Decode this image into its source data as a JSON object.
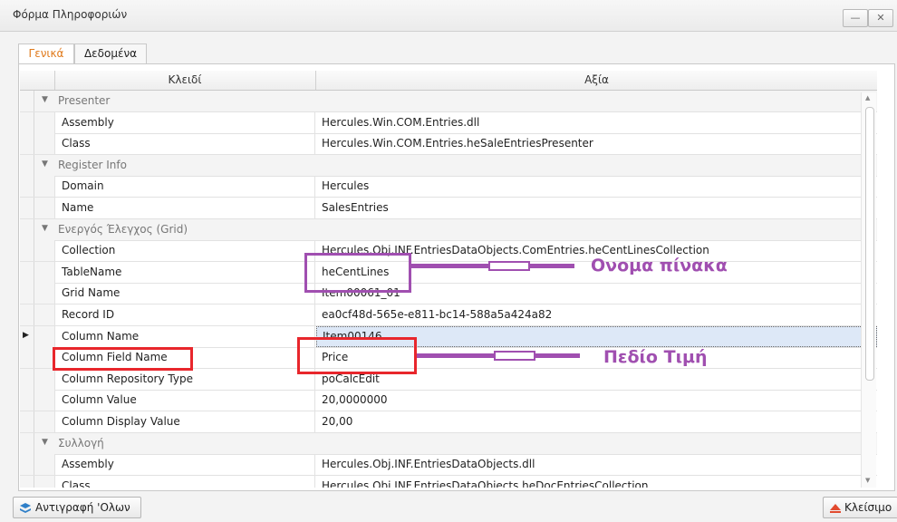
{
  "window": {
    "title": "Φόρμα Πληροφοριών",
    "minimize": "—",
    "close": "✕"
  },
  "tabs": [
    {
      "label": "Γενικά",
      "active": true
    },
    {
      "label": "Δεδομένα",
      "active": false
    }
  ],
  "grid": {
    "headers": {
      "key": "Κλειδί",
      "value": "Αξία"
    },
    "rows": [
      {
        "type": "category",
        "label": "Presenter"
      },
      {
        "type": "property",
        "key": "Assembly",
        "value": "Hercules.Win.COM.Entries.dll"
      },
      {
        "type": "property",
        "key": "Class",
        "value": "Hercules.Win.COM.Entries.heSaleEntriesPresenter"
      },
      {
        "type": "category",
        "label": "Register Info"
      },
      {
        "type": "property",
        "key": "Domain",
        "value": "Hercules"
      },
      {
        "type": "property",
        "key": "Name",
        "value": "SalesEntries"
      },
      {
        "type": "category",
        "label": "Ενεργός Έλεγχος (Grid)"
      },
      {
        "type": "property",
        "key": "Collection",
        "value": "Hercules.Obj.INF.EntriesDataObjects.ComEntries.heCentLinesCollection"
      },
      {
        "type": "property",
        "key": "TableName",
        "value": "heCentLines"
      },
      {
        "type": "property",
        "key": "Grid Name",
        "value": "Item00061_01"
      },
      {
        "type": "property",
        "key": "Record ID",
        "value": "ea0cf48d-565e-e811-bc14-588a5a424a82"
      },
      {
        "type": "property",
        "key": "Column Name",
        "value": "Item00146",
        "selected": true
      },
      {
        "type": "property",
        "key": "Column Field Name",
        "value": "Price"
      },
      {
        "type": "property",
        "key": "Column Repository Type",
        "value": "poCalcEdit"
      },
      {
        "type": "property",
        "key": "Column Value",
        "value": "20,0000000"
      },
      {
        "type": "property",
        "key": "Column Display Value",
        "value": "20,00"
      },
      {
        "type": "category",
        "label": "Συλλογή"
      },
      {
        "type": "property",
        "key": "Assembly",
        "value": "Hercules.Obj.INF.EntriesDataObjects.dll"
      },
      {
        "type": "property",
        "key": "Class",
        "value": "Hercules.Obj.INF.EntriesDataObjects.heDocEntriesCollection"
      }
    ]
  },
  "footer": {
    "copy_all": "Αντιγραφή 'Ολων",
    "close": "Κλείσιμο"
  },
  "annotations": {
    "table_name_label": "Ονομα πίνακα",
    "price_field_label": "Πεδίο Τιμή"
  },
  "colors": {
    "annotation_purple": "#a04fb0",
    "annotation_red": "#e8262c",
    "tab_active": "#e07a1c",
    "selected_row": "#dde8f7"
  }
}
